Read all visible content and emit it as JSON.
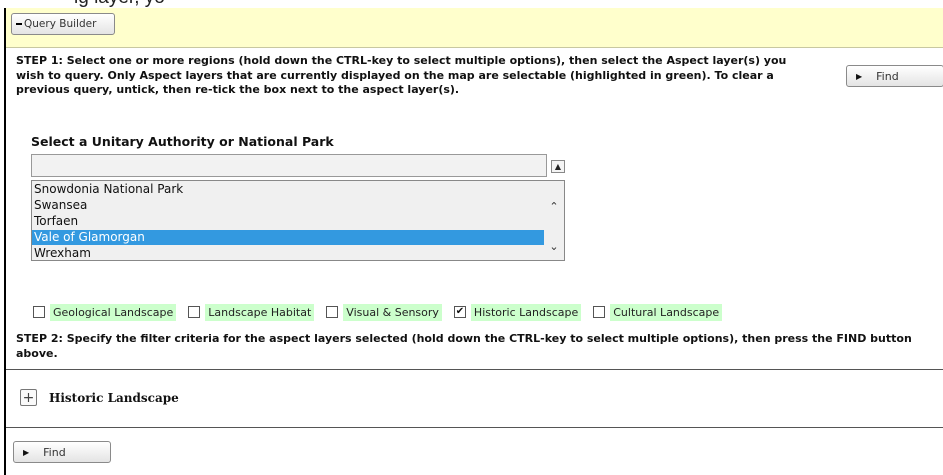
{
  "top_strip": {
    "text": "ig layer, yo"
  },
  "header": {
    "query_builder_label": "Query Builder"
  },
  "step1": {
    "text": "STEP 1: Select one or more regions (hold down the CTRL-key to select multiple options), then select the Aspect layer(s) you wish to query. Only Aspect layers that are currently displayed on the map are selectable (highlighted in green). To clear a previous query, untick, then re-tick the box next to the aspect layer(s)."
  },
  "find_label": "Find",
  "region_select": {
    "label": "Select a Unitary Authority or National Park",
    "input_value": "",
    "items": [
      {
        "label": "Snowdonia National Park",
        "selected": false
      },
      {
        "label": "Swansea",
        "selected": false
      },
      {
        "label": "Torfaen",
        "selected": false
      },
      {
        "label": "Vale of Glamorgan",
        "selected": true
      },
      {
        "label": "Wrexham",
        "selected": false
      }
    ]
  },
  "aspect_layers": [
    {
      "label": "Geological Landscape",
      "checked": false,
      "available": true
    },
    {
      "label": "Landscape Habitat",
      "checked": false,
      "available": true
    },
    {
      "label": "Visual & Sensory",
      "checked": false,
      "available": true
    },
    {
      "label": "Historic Landscape",
      "checked": true,
      "available": true
    },
    {
      "label": "Cultural Landscape",
      "checked": false,
      "available": true
    }
  ],
  "step2": {
    "text": "STEP 2: Specify the filter criteria for the aspect layers selected (hold down the CTRL-key to select multiple options), then press the FIND button above."
  },
  "filter_section": {
    "title": "Historic Landscape"
  },
  "colors": {
    "header_bg": "#ffffcc",
    "available_layer_bg": "#ccffcc",
    "selected_item_bg": "#3399e0"
  }
}
